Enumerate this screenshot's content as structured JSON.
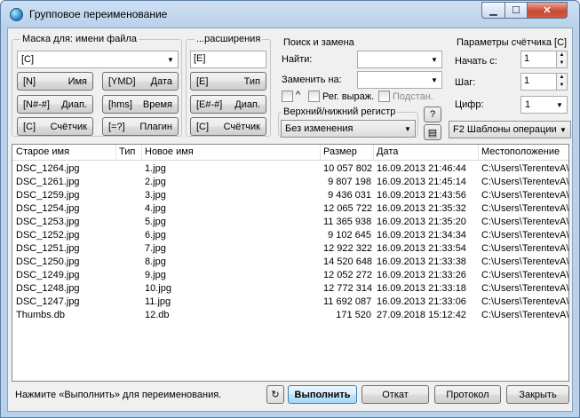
{
  "window": {
    "title": "Групповое переименование"
  },
  "mask": {
    "group_label": "Маска для: имени файла",
    "name_value": "[C]",
    "buttons": [
      {
        "key": "[N]",
        "label": "Имя"
      },
      {
        "key": "[YMD]",
        "label": "Дата"
      },
      {
        "key": "[N#-#]",
        "label": "Диап."
      },
      {
        "key": "[hms]",
        "label": "Время"
      },
      {
        "key": "[C]",
        "label": "Счётчик"
      },
      {
        "key": "[=?]",
        "label": "Плагин"
      }
    ]
  },
  "ext": {
    "group_label": "...расширения",
    "value": "[E]",
    "buttons": [
      {
        "key": "[E]",
        "label": "Тип"
      },
      {
        "key": "[E#-#]",
        "label": "Диап."
      },
      {
        "key": "[C]",
        "label": "Счётчик"
      }
    ]
  },
  "search": {
    "group_label": "Поиск и замена",
    "find_label": "Найти:",
    "find_value": "",
    "replace_label": "Заменить на:",
    "replace_value": "",
    "opt_caret": "^",
    "opt_regex": "Рег. выраж.",
    "opt_subst": "Подстан.",
    "case_label": "Верхний/нижний регистр",
    "case_value": "Без изменения",
    "help": "?"
  },
  "counter": {
    "group_label": "Параметры счётчика [C]",
    "start_label": "Начать с:",
    "start_value": "1",
    "step_label": "Шаг:",
    "step_value": "1",
    "digits_label": "Цифр:",
    "digits_value": "1",
    "templates": "F2 Шаблоны операции"
  },
  "table": {
    "columns": [
      "Старое имя",
      "Тип",
      "Новое имя",
      "Размер",
      "Дата",
      "Местоположение"
    ],
    "rows": [
      {
        "old": "DSC_1264.jpg",
        "type": "",
        "new": "1.jpg",
        "size": "10 057 802",
        "date": "16.09.2013 21:46:44",
        "loc": "C:\\Users\\TerentevA\\"
      },
      {
        "old": "DSC_1261.jpg",
        "type": "",
        "new": "2.jpg",
        "size": "9 807 198",
        "date": "16.09.2013 21:45:14",
        "loc": "C:\\Users\\TerentevA\\"
      },
      {
        "old": "DSC_1259.jpg",
        "type": "",
        "new": "3.jpg",
        "size": "9 436 031",
        "date": "16.09.2013 21:43:56",
        "loc": "C:\\Users\\TerentevA\\"
      },
      {
        "old": "DSC_1254.jpg",
        "type": "",
        "new": "4.jpg",
        "size": "12 065 722",
        "date": "16.09.2013 21:35:32",
        "loc": "C:\\Users\\TerentevA\\"
      },
      {
        "old": "DSC_1253.jpg",
        "type": "",
        "new": "5.jpg",
        "size": "11 365 938",
        "date": "16.09.2013 21:35:20",
        "loc": "C:\\Users\\TerentevA\\"
      },
      {
        "old": "DSC_1252.jpg",
        "type": "",
        "new": "6.jpg",
        "size": "9 102 645",
        "date": "16.09.2013 21:34:34",
        "loc": "C:\\Users\\TerentevA\\"
      },
      {
        "old": "DSC_1251.jpg",
        "type": "",
        "new": "7.jpg",
        "size": "12 922 322",
        "date": "16.09.2013 21:33:54",
        "loc": "C:\\Users\\TerentevA\\"
      },
      {
        "old": "DSC_1250.jpg",
        "type": "",
        "new": "8.jpg",
        "size": "14 520 648",
        "date": "16.09.2013 21:33:38",
        "loc": "C:\\Users\\TerentevA\\"
      },
      {
        "old": "DSC_1249.jpg",
        "type": "",
        "new": "9.jpg",
        "size": "12 052 272",
        "date": "16.09.2013 21:33:26",
        "loc": "C:\\Users\\TerentevA\\"
      },
      {
        "old": "DSC_1248.jpg",
        "type": "",
        "new": "10.jpg",
        "size": "12 772 314",
        "date": "16.09.2013 21:33:18",
        "loc": "C:\\Users\\TerentevA\\"
      },
      {
        "old": "DSC_1247.jpg",
        "type": "",
        "new": "11.jpg",
        "size": "11 692 087",
        "date": "16.09.2013 21:33:06",
        "loc": "C:\\Users\\TerentevA\\"
      },
      {
        "old": "Thumbs.db",
        "type": "",
        "new": "12.db",
        "size": "171 520",
        "date": "27.09.2018 15:12:42",
        "loc": "C:\\Users\\TerentevA\\"
      }
    ]
  },
  "footer": {
    "status": "Нажмите «Выполнить» для переименования.",
    "run": "Выполнить",
    "rollback": "Откат",
    "log": "Протокол",
    "close": "Закрыть"
  }
}
